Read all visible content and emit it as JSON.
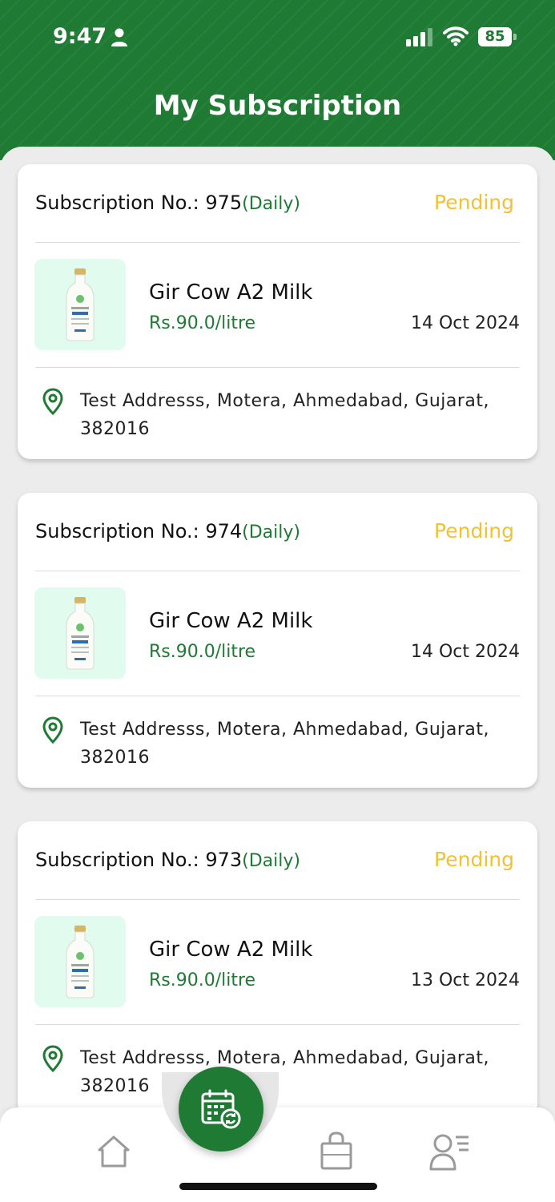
{
  "status_bar": {
    "time": "9:47",
    "battery": "85"
  },
  "header": {
    "title": "My Subscription"
  },
  "subscriptions": [
    {
      "label": "Subscription No.: ",
      "number": "975",
      "frequency": "(Daily)",
      "status": "Pending",
      "product": "Gir Cow A2 Milk",
      "price": "Rs.90.0/litre",
      "date": "14 Oct 2024",
      "address_line1": "Test Addresss, Motera, Ahmedabad, Gujarat,",
      "address_line2": "382016"
    },
    {
      "label": "Subscription No.: ",
      "number": "974",
      "frequency": "(Daily)",
      "status": "Pending",
      "product": "Gir Cow A2 Milk",
      "price": "Rs.90.0/litre",
      "date": "14 Oct 2024",
      "address_line1": "Test Addresss, Motera, Ahmedabad, Gujarat,",
      "address_line2": "382016"
    },
    {
      "label": "Subscription No.: ",
      "number": "973",
      "frequency": "(Daily)",
      "status": "Pending",
      "product": "Gir Cow A2 Milk",
      "price": "Rs.90.0/litre",
      "date": "13 Oct 2024",
      "address_line1": "Test Addresss, Motera, Ahmedabad, Gujarat,",
      "address_line2": "382016"
    }
  ],
  "bottom_nav": {
    "items": [
      "home-icon",
      "subscription-calendar-icon",
      "shopping-bag-icon",
      "profile-list-icon"
    ],
    "active": "subscription-calendar-icon"
  },
  "colors": {
    "brand_green": "#1f7a34",
    "pending_yellow": "#f2c232",
    "thumb_bg": "#e2fbef"
  }
}
